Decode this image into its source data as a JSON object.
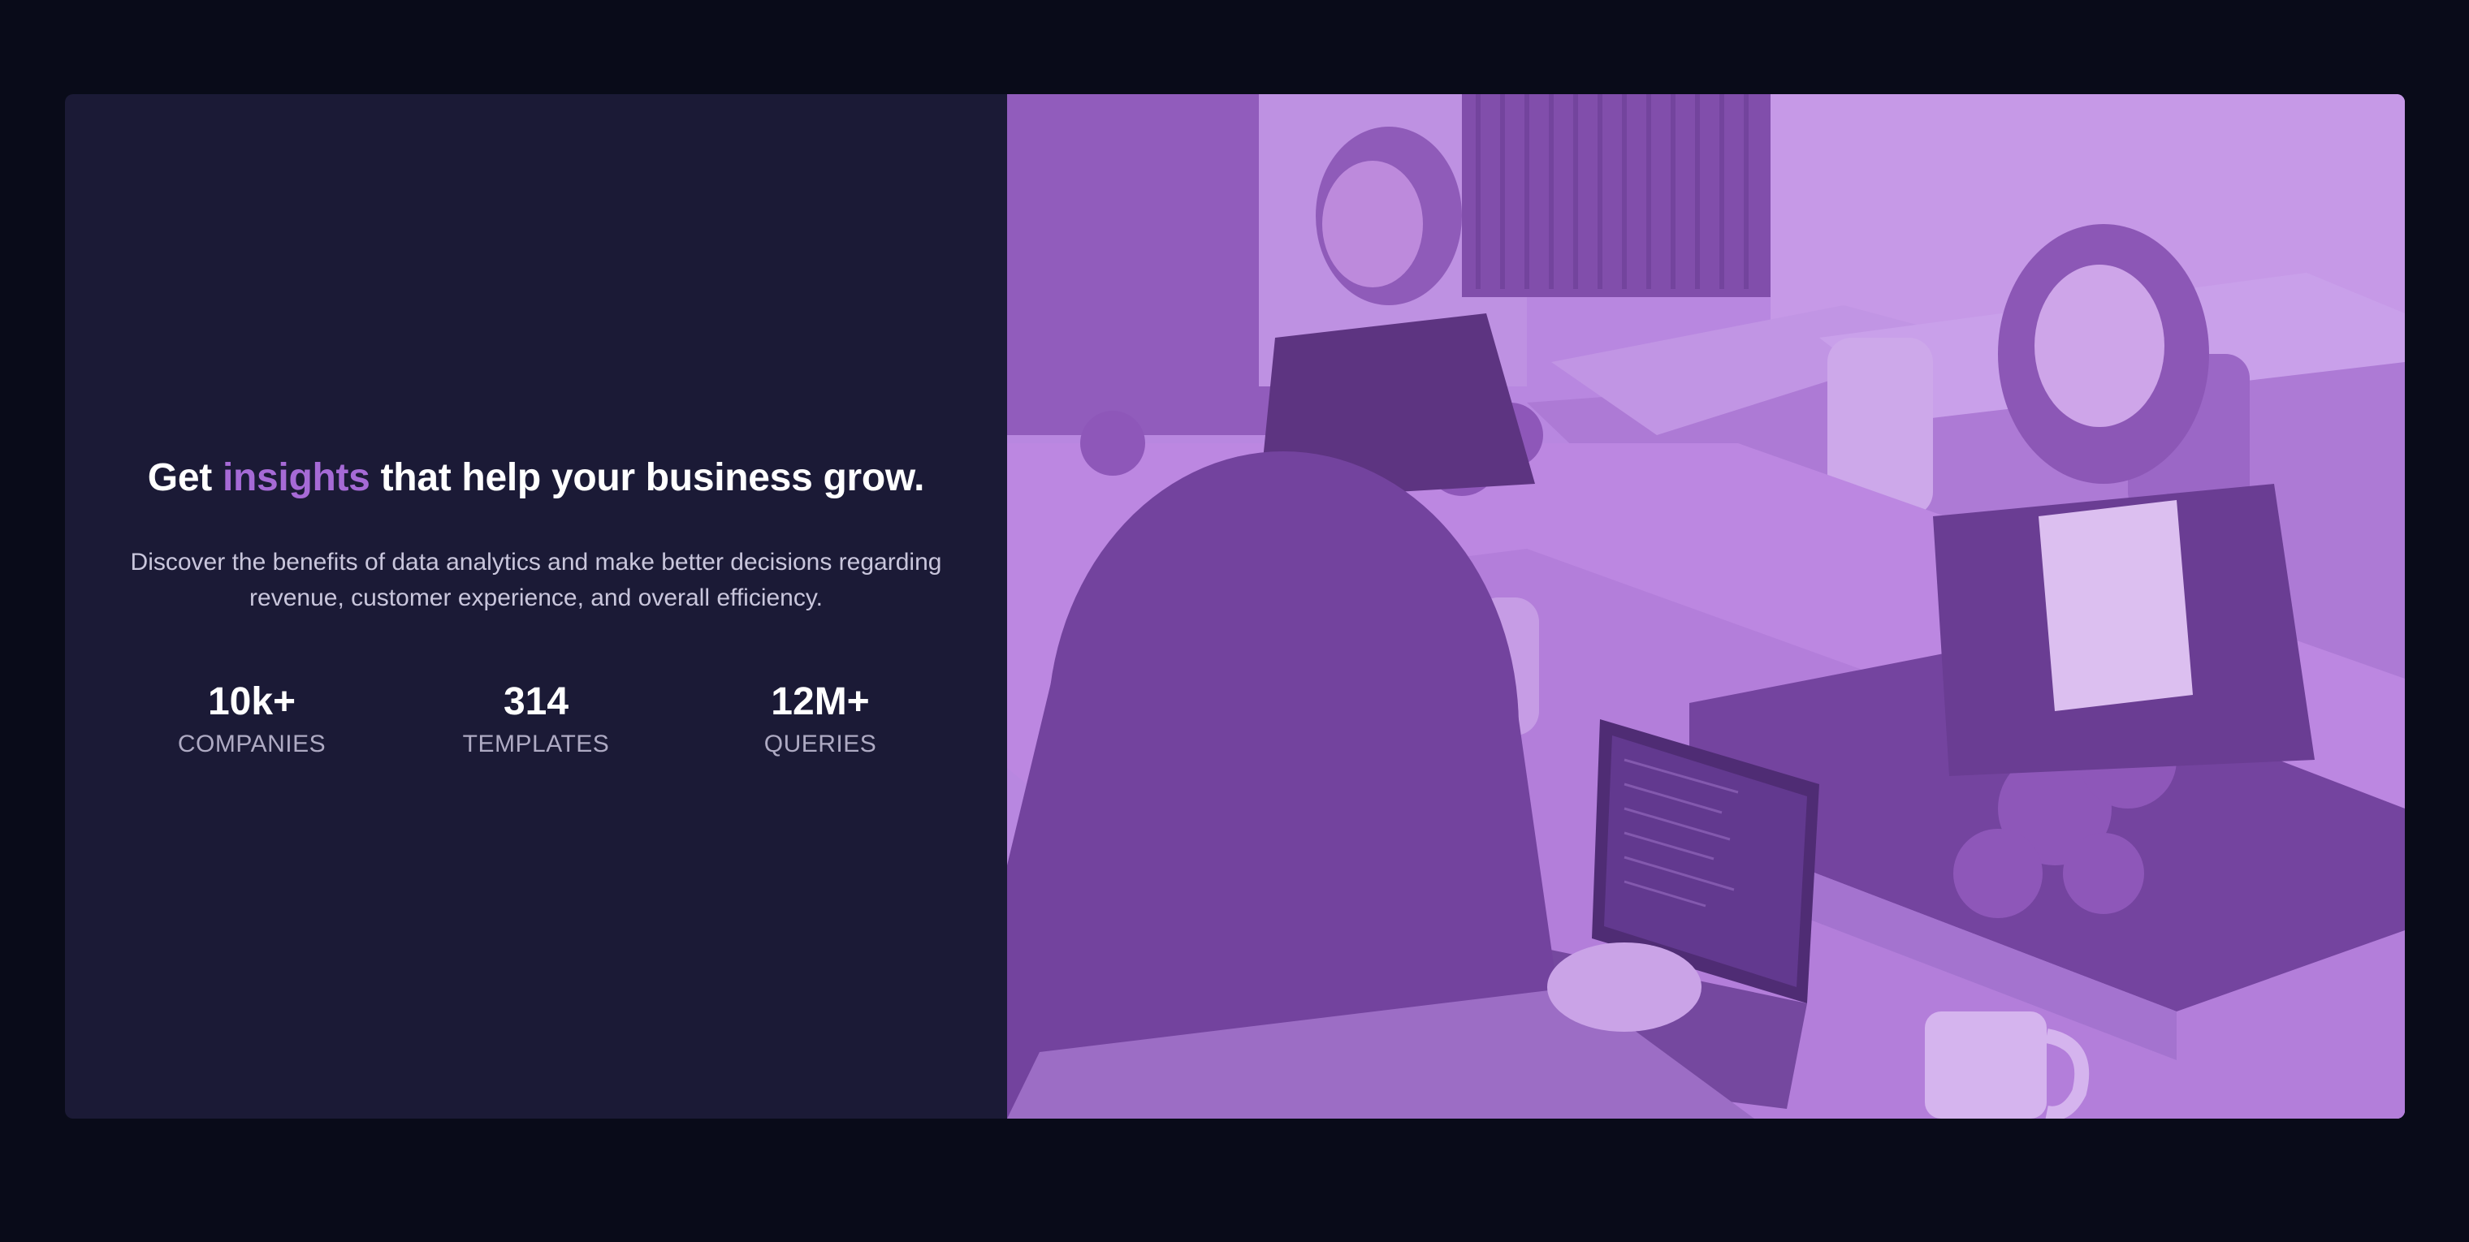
{
  "hero": {
    "headline_prefix": "Get",
    "headline_accent": "insights",
    "headline_suffix": "that help your business grow.",
    "description": "Discover the benefits of data analytics and make better decisions regarding revenue, customer experience, and overall efficiency.",
    "stats": [
      {
        "value": "10k+",
        "label": "COMPANIES"
      },
      {
        "value": "314",
        "label": "TEMPLATES"
      },
      {
        "value": "12M+",
        "label": "QUERIES"
      }
    ]
  },
  "colors": {
    "page_background": "#090b19",
    "card_background": "#1b1a36",
    "accent": "#a66ad6",
    "image_tint": "#b78be0"
  },
  "image": {
    "icon": "office-team-photo"
  }
}
